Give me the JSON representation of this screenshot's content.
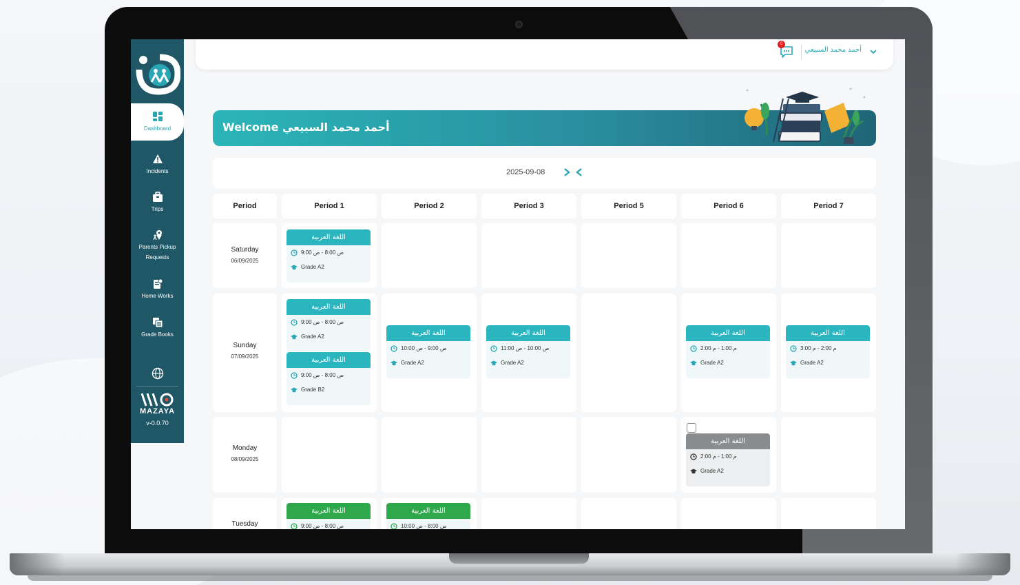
{
  "sidebar": {
    "items": [
      {
        "label": "Dashboard",
        "icon": "dashboard-icon",
        "active": true
      },
      {
        "label": "Incidents",
        "icon": "warning-icon"
      },
      {
        "label": "Trips",
        "icon": "briefcase-icon"
      },
      {
        "label": "Parents Pickup Requests",
        "icon": "pickup-location-icon"
      },
      {
        "label": "Home Works",
        "icon": "homework-icon"
      },
      {
        "label": "Grade Books",
        "icon": "gradebook-icon"
      }
    ],
    "brand": "MAZAYA",
    "version": "v-0.0.70"
  },
  "header": {
    "user_name": "أحمد محمد السبيعي",
    "notification_count": "0"
  },
  "banner": {
    "text": "Welcome أحمد محمد السبيعي"
  },
  "date_nav": {
    "date": "2025-09-08"
  },
  "schedule": {
    "columns": [
      "Period",
      "Period 1",
      "Period 2",
      "Period 3",
      "Period 5",
      "Period 6",
      "Period 7"
    ],
    "days": [
      {
        "name": "Saturday",
        "date": "06/09/2025"
      },
      {
        "name": "Sunday",
        "date": "07/09/2025"
      },
      {
        "name": "Monday",
        "date": "08/09/2025"
      },
      {
        "name": "Tuesday",
        "date": ""
      }
    ],
    "lessons": {
      "sat_p1": {
        "subject": "اللغة العربية",
        "time": "ص 8:00 - ص 9:00",
        "grade": "Grade A2"
      },
      "sun_p1a": {
        "subject": "اللغة العربية",
        "time": "ص 8:00 - ص 9:00",
        "grade": "Grade A2"
      },
      "sun_p1b": {
        "subject": "اللغة العربية",
        "time": "ص 8:00 - ص 9:00",
        "grade": "Grade B2"
      },
      "sun_p2": {
        "subject": "اللغة العربية",
        "time": "ص 9:00 - ص 10:00",
        "grade": "Grade A2"
      },
      "sun_p3": {
        "subject": "اللغة العربية",
        "time": "ص 10:00 - ص 11:00",
        "grade": "Grade A2"
      },
      "sun_p6": {
        "subject": "اللغة العربية",
        "time": "م 1:00 - م 2:00",
        "grade": "Grade A2"
      },
      "sun_p7": {
        "subject": "اللغة العربية",
        "time": "م 2:00 - م 3:00",
        "grade": "Grade A2"
      },
      "mon_p6": {
        "subject": "اللغة العربية",
        "time": "م 1:00 - م 2:00",
        "grade": "Grade A2"
      },
      "tue_p1": {
        "subject": "اللغة العربية",
        "time": "ص 8:00 - ص 9:00"
      },
      "tue_p2": {
        "subject": "اللغة العربية",
        "time": "ص 8:00 - ص 10:00"
      }
    }
  },
  "colors": {
    "sidebar": "#1f5766",
    "accent": "#2aa6b5",
    "lesson_teal": "#2bb5bf",
    "lesson_gray": "#8a8d90",
    "lesson_green": "#2ea84a"
  }
}
